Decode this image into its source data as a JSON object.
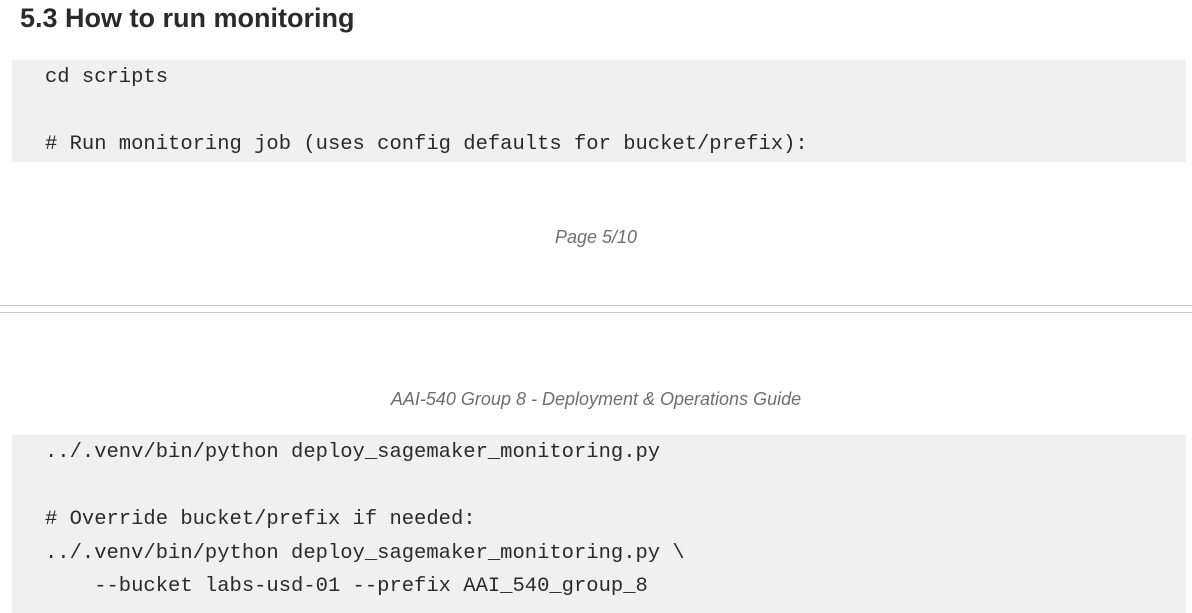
{
  "section": {
    "heading": "5.3 How to run monitoring"
  },
  "code_top": {
    "lines": [
      "cd scripts",
      "",
      "# Run monitoring job (uses config defaults for bucket/prefix):"
    ]
  },
  "page_footer": {
    "page_label": "Page 5/10"
  },
  "page_header": {
    "title": "AAI-540 Group 8 - Deployment & Operations Guide"
  },
  "code_bottom": {
    "lines": [
      "../.venv/bin/python deploy_sagemaker_monitoring.py",
      "",
      "# Override bucket/prefix if needed:",
      "../.venv/bin/python deploy_sagemaker_monitoring.py \\",
      "    --bucket labs-usd-01 --prefix AAI_540_group_8"
    ]
  }
}
